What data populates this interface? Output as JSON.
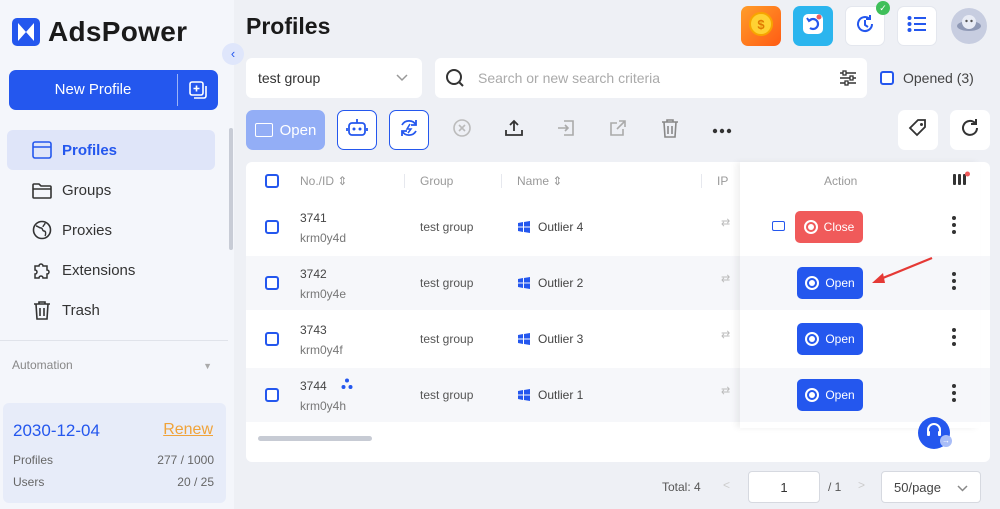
{
  "app": {
    "name": "AdsPower"
  },
  "sidebar": {
    "new_profile_label": "New Profile",
    "items": [
      {
        "label": "Profiles",
        "icon": "profiles-icon"
      },
      {
        "label": "Groups",
        "icon": "folder-icon"
      },
      {
        "label": "Proxies",
        "icon": "globe-icon"
      },
      {
        "label": "Extensions",
        "icon": "puzzle-icon"
      },
      {
        "label": "Trash",
        "icon": "trash-icon"
      }
    ],
    "automation_label": "Automation",
    "plan": {
      "expiry": "2030-12-04",
      "renew_label": "Renew",
      "profiles_label": "Profiles",
      "profiles_value": "277 / 1000",
      "users_label": "Users",
      "users_value": "20 / 25"
    }
  },
  "header": {
    "title": "Profiles"
  },
  "filters": {
    "group_value": "test group",
    "search_placeholder": "Search or new search criteria",
    "opened_label": "Opened (3)"
  },
  "toolbar": {
    "open_label": "Open"
  },
  "table": {
    "columns": {
      "no_id": "No./ID",
      "group": "Group",
      "name": "Name",
      "ip": "IP",
      "action": "Action"
    },
    "rows": [
      {
        "no": "3741",
        "id": "krm0y4d",
        "group": "test group",
        "name": "Outlier 4",
        "action": "Close"
      },
      {
        "no": "3742",
        "id": "krm0y4e",
        "group": "test group",
        "name": "Outlier 2",
        "action": "Open"
      },
      {
        "no": "3743",
        "id": "krm0y4f",
        "group": "test group",
        "name": "Outlier 3",
        "action": "Open"
      },
      {
        "no": "3744",
        "id": "krm0y4h",
        "group": "test group",
        "name": "Outlier 1",
        "action": "Open"
      }
    ]
  },
  "pagination": {
    "total": "Total: 4",
    "prev": "<",
    "page": "1",
    "page_total": "/ 1",
    "next": ">",
    "page_size": "50/page"
  },
  "colors": {
    "primary": "#2457ee",
    "danger": "#f05a5a",
    "renew": "#f0a33a"
  }
}
